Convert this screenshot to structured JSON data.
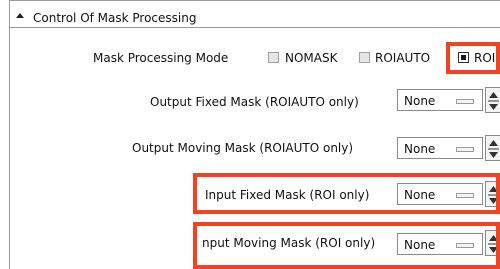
{
  "panel": {
    "title": "Control Of Mask Processing"
  },
  "mode": {
    "label": "Mask Processing Mode",
    "options": [
      {
        "label": "NOMASK",
        "checked": false
      },
      {
        "label": "ROIAUTO",
        "checked": false
      },
      {
        "label": "ROI",
        "checked": true
      }
    ]
  },
  "rows": [
    {
      "label": "Output Fixed Mask (ROIAUTO only)",
      "value": "None"
    },
    {
      "label": "Output Moving Mask (ROIAUTO only)",
      "value": "None"
    },
    {
      "label": "Input Fixed Mask (ROI only)",
      "value": "None"
    },
    {
      "label": "nput Moving Mask (ROI only)",
      "value": "None"
    }
  ],
  "colors": {
    "highlight": "#f4411f",
    "border": "#9a9a9a"
  },
  "icons": {
    "collapse": "triangle-up-icon",
    "spin": "spinner-arrows-icon",
    "dropdown": "dropdown-handle-icon"
  }
}
